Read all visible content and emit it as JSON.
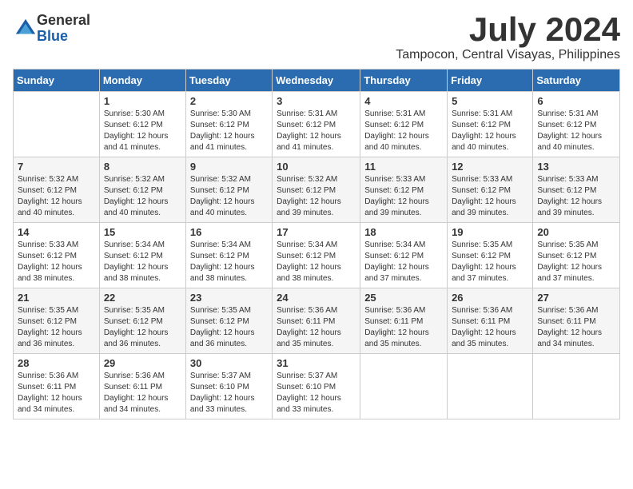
{
  "logo": {
    "general": "General",
    "blue": "Blue"
  },
  "title": {
    "month": "July 2024",
    "location": "Tampocon, Central Visayas, Philippines"
  },
  "headers": [
    "Sunday",
    "Monday",
    "Tuesday",
    "Wednesday",
    "Thursday",
    "Friday",
    "Saturday"
  ],
  "weeks": [
    [
      {
        "day": "",
        "sunrise": "",
        "sunset": "",
        "daylight": ""
      },
      {
        "day": "1",
        "sunrise": "Sunrise: 5:30 AM",
        "sunset": "Sunset: 6:12 PM",
        "daylight": "Daylight: 12 hours and 41 minutes."
      },
      {
        "day": "2",
        "sunrise": "Sunrise: 5:30 AM",
        "sunset": "Sunset: 6:12 PM",
        "daylight": "Daylight: 12 hours and 41 minutes."
      },
      {
        "day": "3",
        "sunrise": "Sunrise: 5:31 AM",
        "sunset": "Sunset: 6:12 PM",
        "daylight": "Daylight: 12 hours and 41 minutes."
      },
      {
        "day": "4",
        "sunrise": "Sunrise: 5:31 AM",
        "sunset": "Sunset: 6:12 PM",
        "daylight": "Daylight: 12 hours and 40 minutes."
      },
      {
        "day": "5",
        "sunrise": "Sunrise: 5:31 AM",
        "sunset": "Sunset: 6:12 PM",
        "daylight": "Daylight: 12 hours and 40 minutes."
      },
      {
        "day": "6",
        "sunrise": "Sunrise: 5:31 AM",
        "sunset": "Sunset: 6:12 PM",
        "daylight": "Daylight: 12 hours and 40 minutes."
      }
    ],
    [
      {
        "day": "7",
        "sunrise": "Sunrise: 5:32 AM",
        "sunset": "Sunset: 6:12 PM",
        "daylight": "Daylight: 12 hours and 40 minutes."
      },
      {
        "day": "8",
        "sunrise": "Sunrise: 5:32 AM",
        "sunset": "Sunset: 6:12 PM",
        "daylight": "Daylight: 12 hours and 40 minutes."
      },
      {
        "day": "9",
        "sunrise": "Sunrise: 5:32 AM",
        "sunset": "Sunset: 6:12 PM",
        "daylight": "Daylight: 12 hours and 40 minutes."
      },
      {
        "day": "10",
        "sunrise": "Sunrise: 5:32 AM",
        "sunset": "Sunset: 6:12 PM",
        "daylight": "Daylight: 12 hours and 39 minutes."
      },
      {
        "day": "11",
        "sunrise": "Sunrise: 5:33 AM",
        "sunset": "Sunset: 6:12 PM",
        "daylight": "Daylight: 12 hours and 39 minutes."
      },
      {
        "day": "12",
        "sunrise": "Sunrise: 5:33 AM",
        "sunset": "Sunset: 6:12 PM",
        "daylight": "Daylight: 12 hours and 39 minutes."
      },
      {
        "day": "13",
        "sunrise": "Sunrise: 5:33 AM",
        "sunset": "Sunset: 6:12 PM",
        "daylight": "Daylight: 12 hours and 39 minutes."
      }
    ],
    [
      {
        "day": "14",
        "sunrise": "Sunrise: 5:33 AM",
        "sunset": "Sunset: 6:12 PM",
        "daylight": "Daylight: 12 hours and 38 minutes."
      },
      {
        "day": "15",
        "sunrise": "Sunrise: 5:34 AM",
        "sunset": "Sunset: 6:12 PM",
        "daylight": "Daylight: 12 hours and 38 minutes."
      },
      {
        "day": "16",
        "sunrise": "Sunrise: 5:34 AM",
        "sunset": "Sunset: 6:12 PM",
        "daylight": "Daylight: 12 hours and 38 minutes."
      },
      {
        "day": "17",
        "sunrise": "Sunrise: 5:34 AM",
        "sunset": "Sunset: 6:12 PM",
        "daylight": "Daylight: 12 hours and 38 minutes."
      },
      {
        "day": "18",
        "sunrise": "Sunrise: 5:34 AM",
        "sunset": "Sunset: 6:12 PM",
        "daylight": "Daylight: 12 hours and 37 minutes."
      },
      {
        "day": "19",
        "sunrise": "Sunrise: 5:35 AM",
        "sunset": "Sunset: 6:12 PM",
        "daylight": "Daylight: 12 hours and 37 minutes."
      },
      {
        "day": "20",
        "sunrise": "Sunrise: 5:35 AM",
        "sunset": "Sunset: 6:12 PM",
        "daylight": "Daylight: 12 hours and 37 minutes."
      }
    ],
    [
      {
        "day": "21",
        "sunrise": "Sunrise: 5:35 AM",
        "sunset": "Sunset: 6:12 PM",
        "daylight": "Daylight: 12 hours and 36 minutes."
      },
      {
        "day": "22",
        "sunrise": "Sunrise: 5:35 AM",
        "sunset": "Sunset: 6:12 PM",
        "daylight": "Daylight: 12 hours and 36 minutes."
      },
      {
        "day": "23",
        "sunrise": "Sunrise: 5:35 AM",
        "sunset": "Sunset: 6:12 PM",
        "daylight": "Daylight: 12 hours and 36 minutes."
      },
      {
        "day": "24",
        "sunrise": "Sunrise: 5:36 AM",
        "sunset": "Sunset: 6:11 PM",
        "daylight": "Daylight: 12 hours and 35 minutes."
      },
      {
        "day": "25",
        "sunrise": "Sunrise: 5:36 AM",
        "sunset": "Sunset: 6:11 PM",
        "daylight": "Daylight: 12 hours and 35 minutes."
      },
      {
        "day": "26",
        "sunrise": "Sunrise: 5:36 AM",
        "sunset": "Sunset: 6:11 PM",
        "daylight": "Daylight: 12 hours and 35 minutes."
      },
      {
        "day": "27",
        "sunrise": "Sunrise: 5:36 AM",
        "sunset": "Sunset: 6:11 PM",
        "daylight": "Daylight: 12 hours and 34 minutes."
      }
    ],
    [
      {
        "day": "28",
        "sunrise": "Sunrise: 5:36 AM",
        "sunset": "Sunset: 6:11 PM",
        "daylight": "Daylight: 12 hours and 34 minutes."
      },
      {
        "day": "29",
        "sunrise": "Sunrise: 5:36 AM",
        "sunset": "Sunset: 6:11 PM",
        "daylight": "Daylight: 12 hours and 34 minutes."
      },
      {
        "day": "30",
        "sunrise": "Sunrise: 5:37 AM",
        "sunset": "Sunset: 6:10 PM",
        "daylight": "Daylight: 12 hours and 33 minutes."
      },
      {
        "day": "31",
        "sunrise": "Sunrise: 5:37 AM",
        "sunset": "Sunset: 6:10 PM",
        "daylight": "Daylight: 12 hours and 33 minutes."
      },
      {
        "day": "",
        "sunrise": "",
        "sunset": "",
        "daylight": ""
      },
      {
        "day": "",
        "sunrise": "",
        "sunset": "",
        "daylight": ""
      },
      {
        "day": "",
        "sunrise": "",
        "sunset": "",
        "daylight": ""
      }
    ]
  ]
}
